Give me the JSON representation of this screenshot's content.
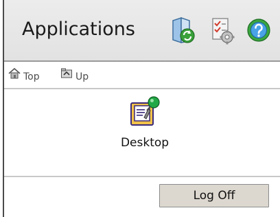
{
  "header": {
    "title": "Applications",
    "tools": [
      {
        "icon": "refresh-icon"
      },
      {
        "icon": "preferences-icon"
      },
      {
        "icon": "help-icon"
      }
    ]
  },
  "nav": {
    "top_label": "Top",
    "up_label": "Up"
  },
  "apps": [
    {
      "label": "Desktop",
      "icon": "desktop-app-icon"
    }
  ],
  "footer": {
    "logoff_label": "Log Off"
  },
  "colors": {
    "header_bg": "#e6e6e6",
    "button_bg": "#dcd7cf",
    "nav_text": "#4d4d4d"
  }
}
